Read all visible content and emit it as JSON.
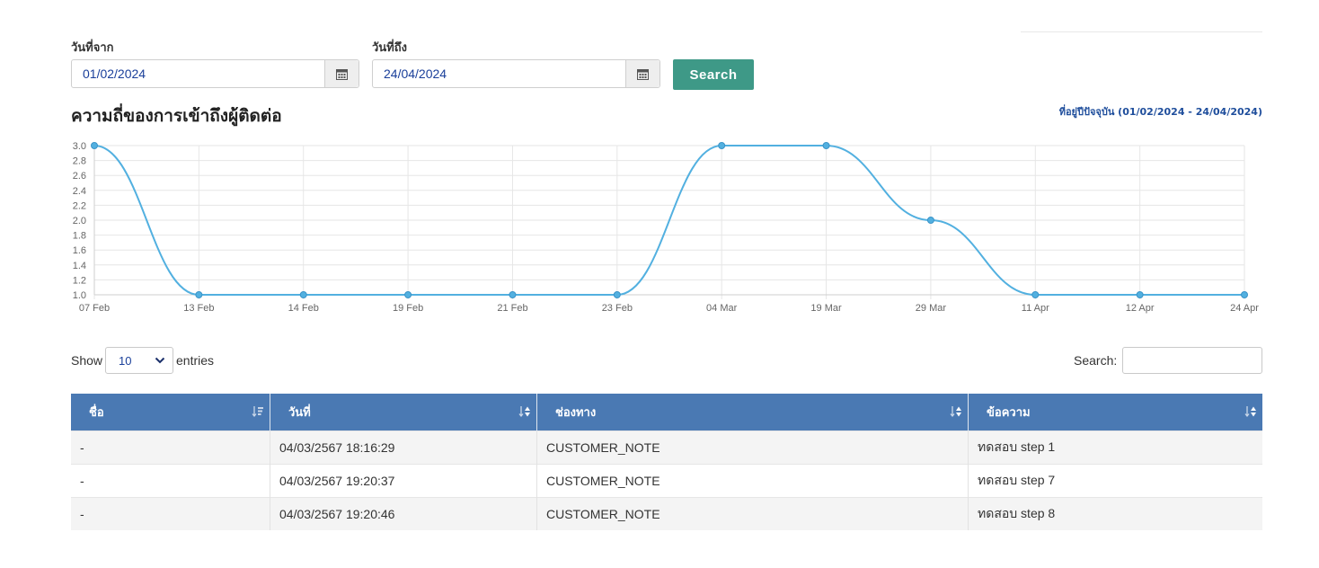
{
  "filters": {
    "from_label": "วันที่จาก",
    "from_value": "01/02/2024",
    "to_label": "วันที่ถึง",
    "to_value": "24/04/2024",
    "search_label": "Search"
  },
  "chart_header": {
    "title": "ความถี่ของการเข้าถึงผู้ติดต่อ",
    "range_link": "ที่อยู่ปีปัจจุบัน (01/02/2024 - 24/04/2024)"
  },
  "chart_data": {
    "type": "line",
    "categories": [
      "07 Feb",
      "13 Feb",
      "14 Feb",
      "19 Feb",
      "21 Feb",
      "23 Feb",
      "04 Mar",
      "19 Mar",
      "29 Mar",
      "11 Apr",
      "12 Apr",
      "24 Apr"
    ],
    "series": [
      {
        "values": [
          3.0,
          1.0,
          1.0,
          1.0,
          1.0,
          1.0,
          3.0,
          3.0,
          2.0,
          1.0,
          1.0,
          1.0
        ],
        "color": "#52b0e0"
      }
    ],
    "y_ticks": [
      "3.0",
      "2.8",
      "2.6",
      "2.4",
      "2.2",
      "2.0",
      "1.8",
      "1.6",
      "1.4",
      "1.2",
      "1.0"
    ],
    "ylim": [
      1.0,
      3.0
    ],
    "grid": true
  },
  "table_controls": {
    "show_label": "Show",
    "length_value": "10",
    "entries_label": "entries",
    "search_label": "Search:"
  },
  "table": {
    "columns": [
      "ชื่อ",
      "วันที่",
      "ช่องทาง",
      "ข้อความ"
    ],
    "rows": [
      [
        "-",
        "04/03/2567 18:16:29",
        "CUSTOMER_NOTE",
        "ทดสอบ step 1"
      ],
      [
        "-",
        "04/03/2567 19:20:37",
        "CUSTOMER_NOTE",
        "ทดสอบ step 7"
      ],
      [
        "-",
        "04/03/2567 19:20:46",
        "CUSTOMER_NOTE",
        "ทดสอบ step 8"
      ]
    ]
  },
  "colors": {
    "primary_button": "#3e9987",
    "table_header": "#4a79b3",
    "line": "#52b0e0",
    "link": "#1f4e9c"
  }
}
